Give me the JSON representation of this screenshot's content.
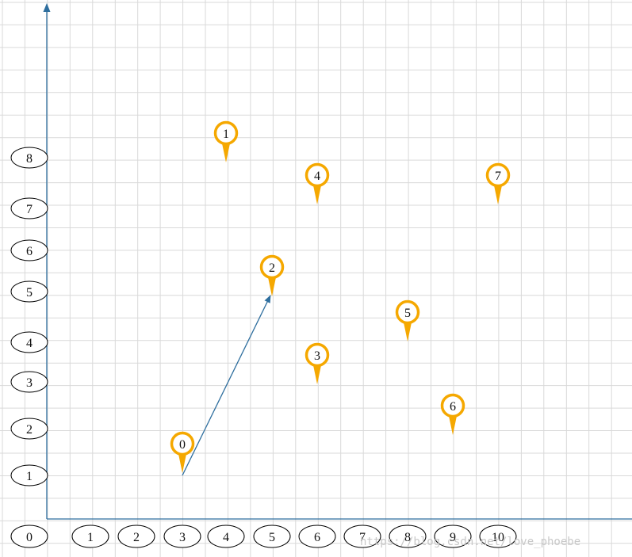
{
  "chart_data": {
    "type": "scatter",
    "x_axis": {
      "ticks": [
        "0",
        "1",
        "2",
        "3",
        "4",
        "5",
        "6",
        "7",
        "8",
        "9",
        "10"
      ]
    },
    "y_axis": {
      "ticks": [
        "1",
        "2",
        "3",
        "4",
        "5",
        "6",
        "7",
        "8"
      ]
    },
    "grid": true,
    "points": [
      {
        "label": "0",
        "x": 3,
        "y": 1
      },
      {
        "label": "1",
        "x": 4,
        "y": 8
      },
      {
        "label": "2",
        "x": 5,
        "y": 5
      },
      {
        "label": "3",
        "x": 6,
        "y": 3
      },
      {
        "label": "4",
        "x": 6,
        "y": 7
      },
      {
        "label": "5",
        "x": 8,
        "y": 4
      },
      {
        "label": "6",
        "x": 9,
        "y": 2
      },
      {
        "label": "7",
        "x": 10,
        "y": 7
      }
    ],
    "arrow": {
      "from": [
        3,
        1
      ],
      "to": [
        5,
        5
      ]
    }
  },
  "watermark": "https://blog.csdn.net/love_phoebe",
  "colors": {
    "grid": "#d9d9d9",
    "axis": "#2e6e9e",
    "pin": "#f5a800",
    "oval_stroke": "#000000",
    "label": "#111111"
  }
}
